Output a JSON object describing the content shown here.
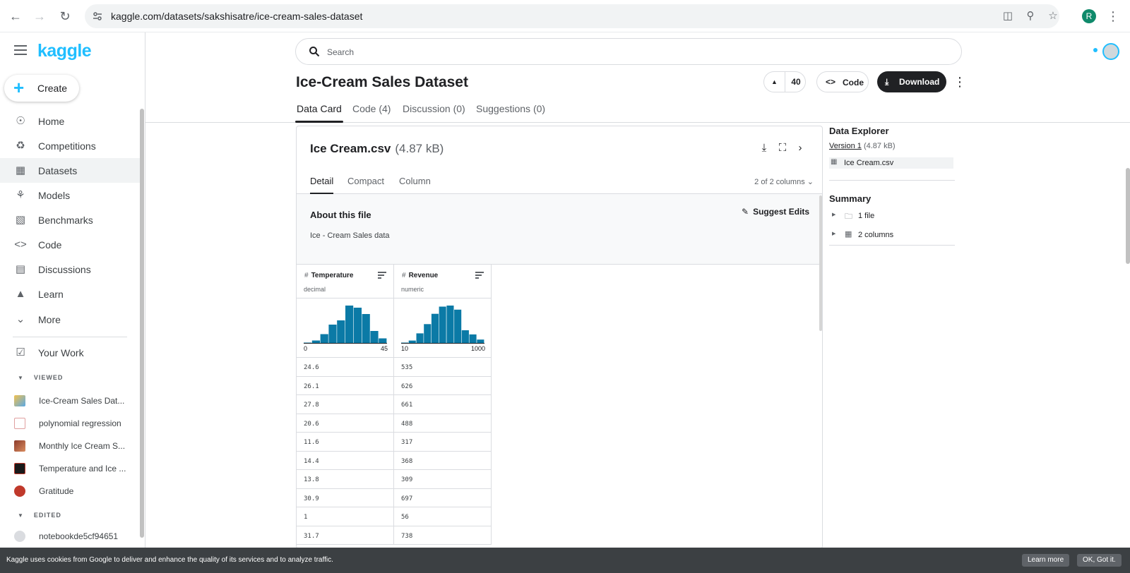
{
  "browser": {
    "url": "kaggle.com/datasets/sakshisatre/ice-cream-sales-dataset",
    "profile_initial": "R"
  },
  "sidebar": {
    "logo": "kaggle",
    "create_label": "Create",
    "nav": [
      {
        "label": "Home",
        "icon": "compass-icon"
      },
      {
        "label": "Competitions",
        "icon": "trophy-icon"
      },
      {
        "label": "Datasets",
        "icon": "table-icon"
      },
      {
        "label": "Models",
        "icon": "models-icon"
      },
      {
        "label": "Benchmarks",
        "icon": "bar-chart-icon"
      },
      {
        "label": "Code",
        "icon": "code-icon"
      },
      {
        "label": "Discussions",
        "icon": "comment-icon"
      },
      {
        "label": "Learn",
        "icon": "school-icon"
      },
      {
        "label": "More",
        "icon": "chevron-down-icon"
      }
    ],
    "your_work": "Your Work",
    "viewed_section": "VIEWED",
    "viewed": [
      {
        "label": "Ice-Cream Sales Dat..."
      },
      {
        "label": "polynomial regression"
      },
      {
        "label": "Monthly Ice Cream S..."
      },
      {
        "label": "Temperature and Ice ..."
      },
      {
        "label": "Gratitude"
      }
    ],
    "edited_section": "EDITED",
    "edited": [
      {
        "label": "notebookde5cf94651"
      }
    ]
  },
  "header": {
    "search_placeholder": "Search",
    "title": "Ice-Cream Sales Dataset",
    "upvotes": "40",
    "code_label": "Code",
    "download_label": "Download"
  },
  "tabs": [
    {
      "label": "Data Card"
    },
    {
      "label": "Code (4)"
    },
    {
      "label": "Discussion (0)"
    },
    {
      "label": "Suggestions (0)"
    }
  ],
  "file": {
    "name": "Ice Cream.csv",
    "size": "(4.87 kB)",
    "subtabs": [
      "Detail",
      "Compact",
      "Column"
    ],
    "column_count": "2 of 2 columns",
    "about_title": "About this file",
    "suggest_label": "Suggest Edits",
    "description": "Ice - Cream Sales data"
  },
  "columns": [
    {
      "name": "Temperature",
      "type": "decimal",
      "min": "0",
      "max": "45",
      "histogram": [
        1,
        3,
        9,
        18,
        22,
        36,
        34,
        28,
        12,
        5
      ],
      "values": [
        "24.6",
        "26.1",
        "27.8",
        "20.6",
        "11.6",
        "14.4",
        "13.8",
        "30.9",
        "1",
        "31.7"
      ]
    },
    {
      "name": "Revenue",
      "type": "numeric",
      "min": "10",
      "max": "1000",
      "histogram": [
        1,
        3,
        10,
        19,
        29,
        36,
        37,
        33,
        13,
        9,
        4
      ],
      "values": [
        "535",
        "626",
        "661",
        "488",
        "317",
        "368",
        "309",
        "697",
        "56",
        "738"
      ]
    }
  ],
  "explorer": {
    "title": "Data Explorer",
    "version_link": "Version 1",
    "version_size": "(4.87 kB)",
    "file": "Ice Cream.csv",
    "summary_title": "Summary",
    "summary": [
      {
        "label": "1 file",
        "icon": "folder-icon"
      },
      {
        "label": "2 columns",
        "icon": "columns-icon"
      }
    ]
  },
  "cookie": {
    "message": "Kaggle uses cookies from Google to deliver and enhance the quality of its services and to analyze traffic.",
    "learn_more": "Learn more",
    "ok": "OK, Got it."
  },
  "colors": {
    "accent": "#20beff",
    "hist_bar": "#0b7aa6",
    "dark": "#202124"
  }
}
